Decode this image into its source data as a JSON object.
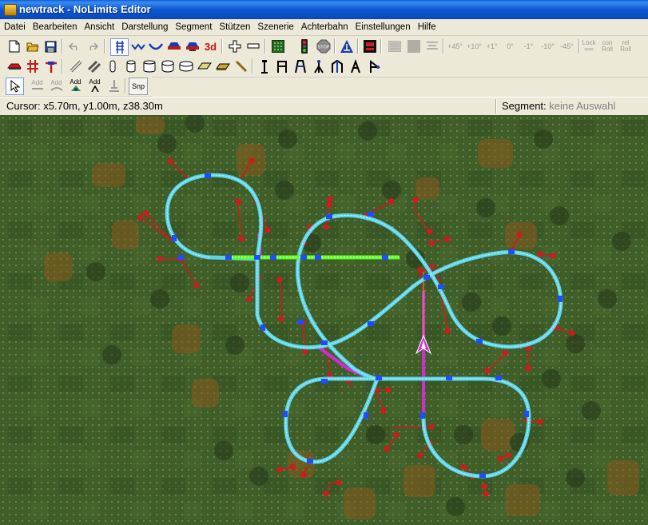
{
  "window": {
    "title": "newtrack - NoLimits Editor",
    "icon": "coaster-app-icon"
  },
  "menu": [
    "Datei",
    "Bearbeiten",
    "Ansicht",
    "Darstellung",
    "Segment",
    "Stützen",
    "Szenerie",
    "Achterbahn",
    "Einstellungen",
    "Hilfe"
  ],
  "toolbar3": {
    "add_labels": [
      "Add",
      "Add",
      "Add",
      "Add"
    ],
    "snap_label": "Snp"
  },
  "toolbar1_text": {
    "three_d": "3d",
    "stop": "STOP",
    "angles": [
      "+45°",
      "+10°",
      "+1°",
      "0°",
      "-1°",
      "-10°",
      "-45°"
    ],
    "lock": "Lock",
    "lock2": "∞∞",
    "con_roll": "con",
    "con_roll2": "Roll",
    "rel_roll": "rel",
    "rel_roll2": "Roll"
  },
  "status": {
    "cursor_label": "Cursor:",
    "cursor_value": "x5.70m, y1.00m, z38.30m",
    "segment_label": "Segment:",
    "segment_value": "keine Auswahl"
  },
  "colors": {
    "grass": "#3b5a26",
    "track": "#5cd3e8",
    "selected_track": "#5aff26",
    "lift_track": "#d22bd6",
    "support": "#d01e1e",
    "node": "#1f4cff"
  }
}
